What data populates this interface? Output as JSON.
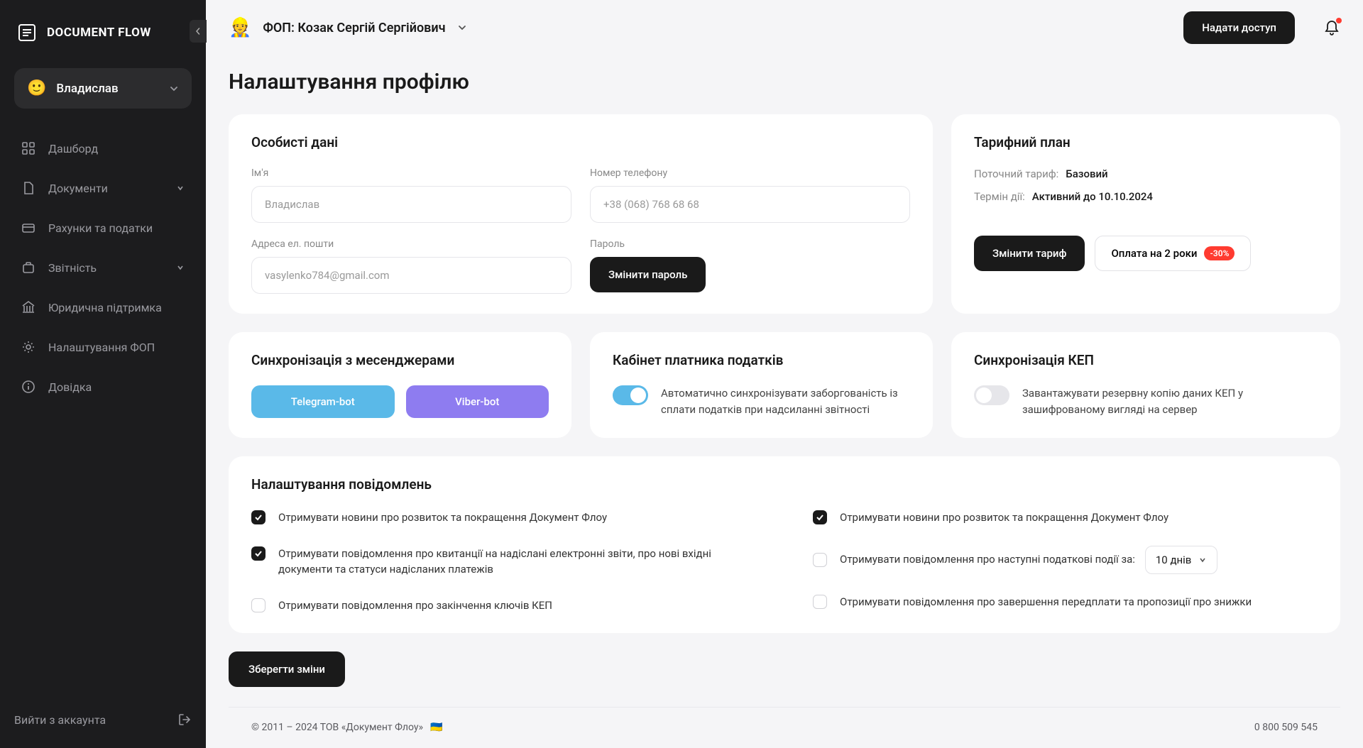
{
  "app": {
    "name": "DOCUMENT FLOW"
  },
  "sidebar": {
    "user": {
      "emoji": "🙂",
      "name": "Владислав"
    },
    "items": [
      {
        "label": "Дашборд",
        "expandable": false
      },
      {
        "label": "Документи",
        "expandable": true
      },
      {
        "label": "Рахунки та податки",
        "expandable": false
      },
      {
        "label": "Звітність",
        "expandable": true
      },
      {
        "label": "Юридична підтримка",
        "expandable": false
      },
      {
        "label": "Налаштування ФОП",
        "expandable": false
      },
      {
        "label": "Довідка",
        "expandable": false
      }
    ],
    "logout": "Вийти з аккаунта"
  },
  "topbar": {
    "org_emoji": "👷",
    "org_name": "ФОП: Козак Сергій Сергійович",
    "grant_access": "Надати доступ"
  },
  "page": {
    "title": "Налаштування профілю"
  },
  "personal": {
    "heading": "Особисті дані",
    "name_label": "Ім'я",
    "name_value": "Владислав",
    "phone_label": "Номер телефону",
    "phone_value": "+38 (068) 768 68 68",
    "email_label": "Адреса ел. пошти",
    "email_value": "vasylenko784@gmail.com",
    "password_label": "Пароль",
    "change_password": "Змінити пароль"
  },
  "plan": {
    "heading": "Тарифний план",
    "current_label": "Поточний тариф:",
    "current_value": "Базовий",
    "term_label": "Термін дії:",
    "term_value": "Активний до 10.10.2024",
    "change": "Змінити тариф",
    "pay2y": "Оплата на 2 роки",
    "discount": "-30%"
  },
  "sync_msg": {
    "heading": "Синхронізація з месенджерами",
    "telegram": "Telegram-bot",
    "viber": "Viber-bot"
  },
  "taxpayer": {
    "heading": "Кабінет платника податків",
    "text": "Автоматично синхронізувати заборгованість із сплати податків при надсиланні звітності"
  },
  "kep": {
    "heading": "Синхронізація КЕП",
    "text": "Завантажувати резервну копію даних КЕП у зашифрованому вигляді на сервер"
  },
  "notif": {
    "heading": "Налаштування повідомлень",
    "items": [
      {
        "label": "Отримувати новини про розвиток та покращення Документ Флоу",
        "checked": true
      },
      {
        "label": "Отримувати повідомлення про квитанції на надіслані електронні звіти, про нові вхідні документи та статуси надісланих платежів",
        "checked": true
      },
      {
        "label": "Отримувати повідомлення про закінчення ключів КЕП",
        "checked": false
      },
      {
        "label": "Отримувати новини про розвиток та покращення Документ Флоу",
        "checked": true
      },
      {
        "label": "Отримувати повідомлення про наступні податкові події за:",
        "checked": false,
        "select": "10 днів"
      },
      {
        "label": "Отримувати повідомлення про завершення передплати та пропозиції про знижки",
        "checked": false
      }
    ]
  },
  "save": "Зберегти зміни",
  "footer": {
    "copyright": "© 2011 – 2024 ТОВ «Документ Флоу»",
    "flag": "🇺🇦",
    "phone": "0 800 509 545"
  }
}
